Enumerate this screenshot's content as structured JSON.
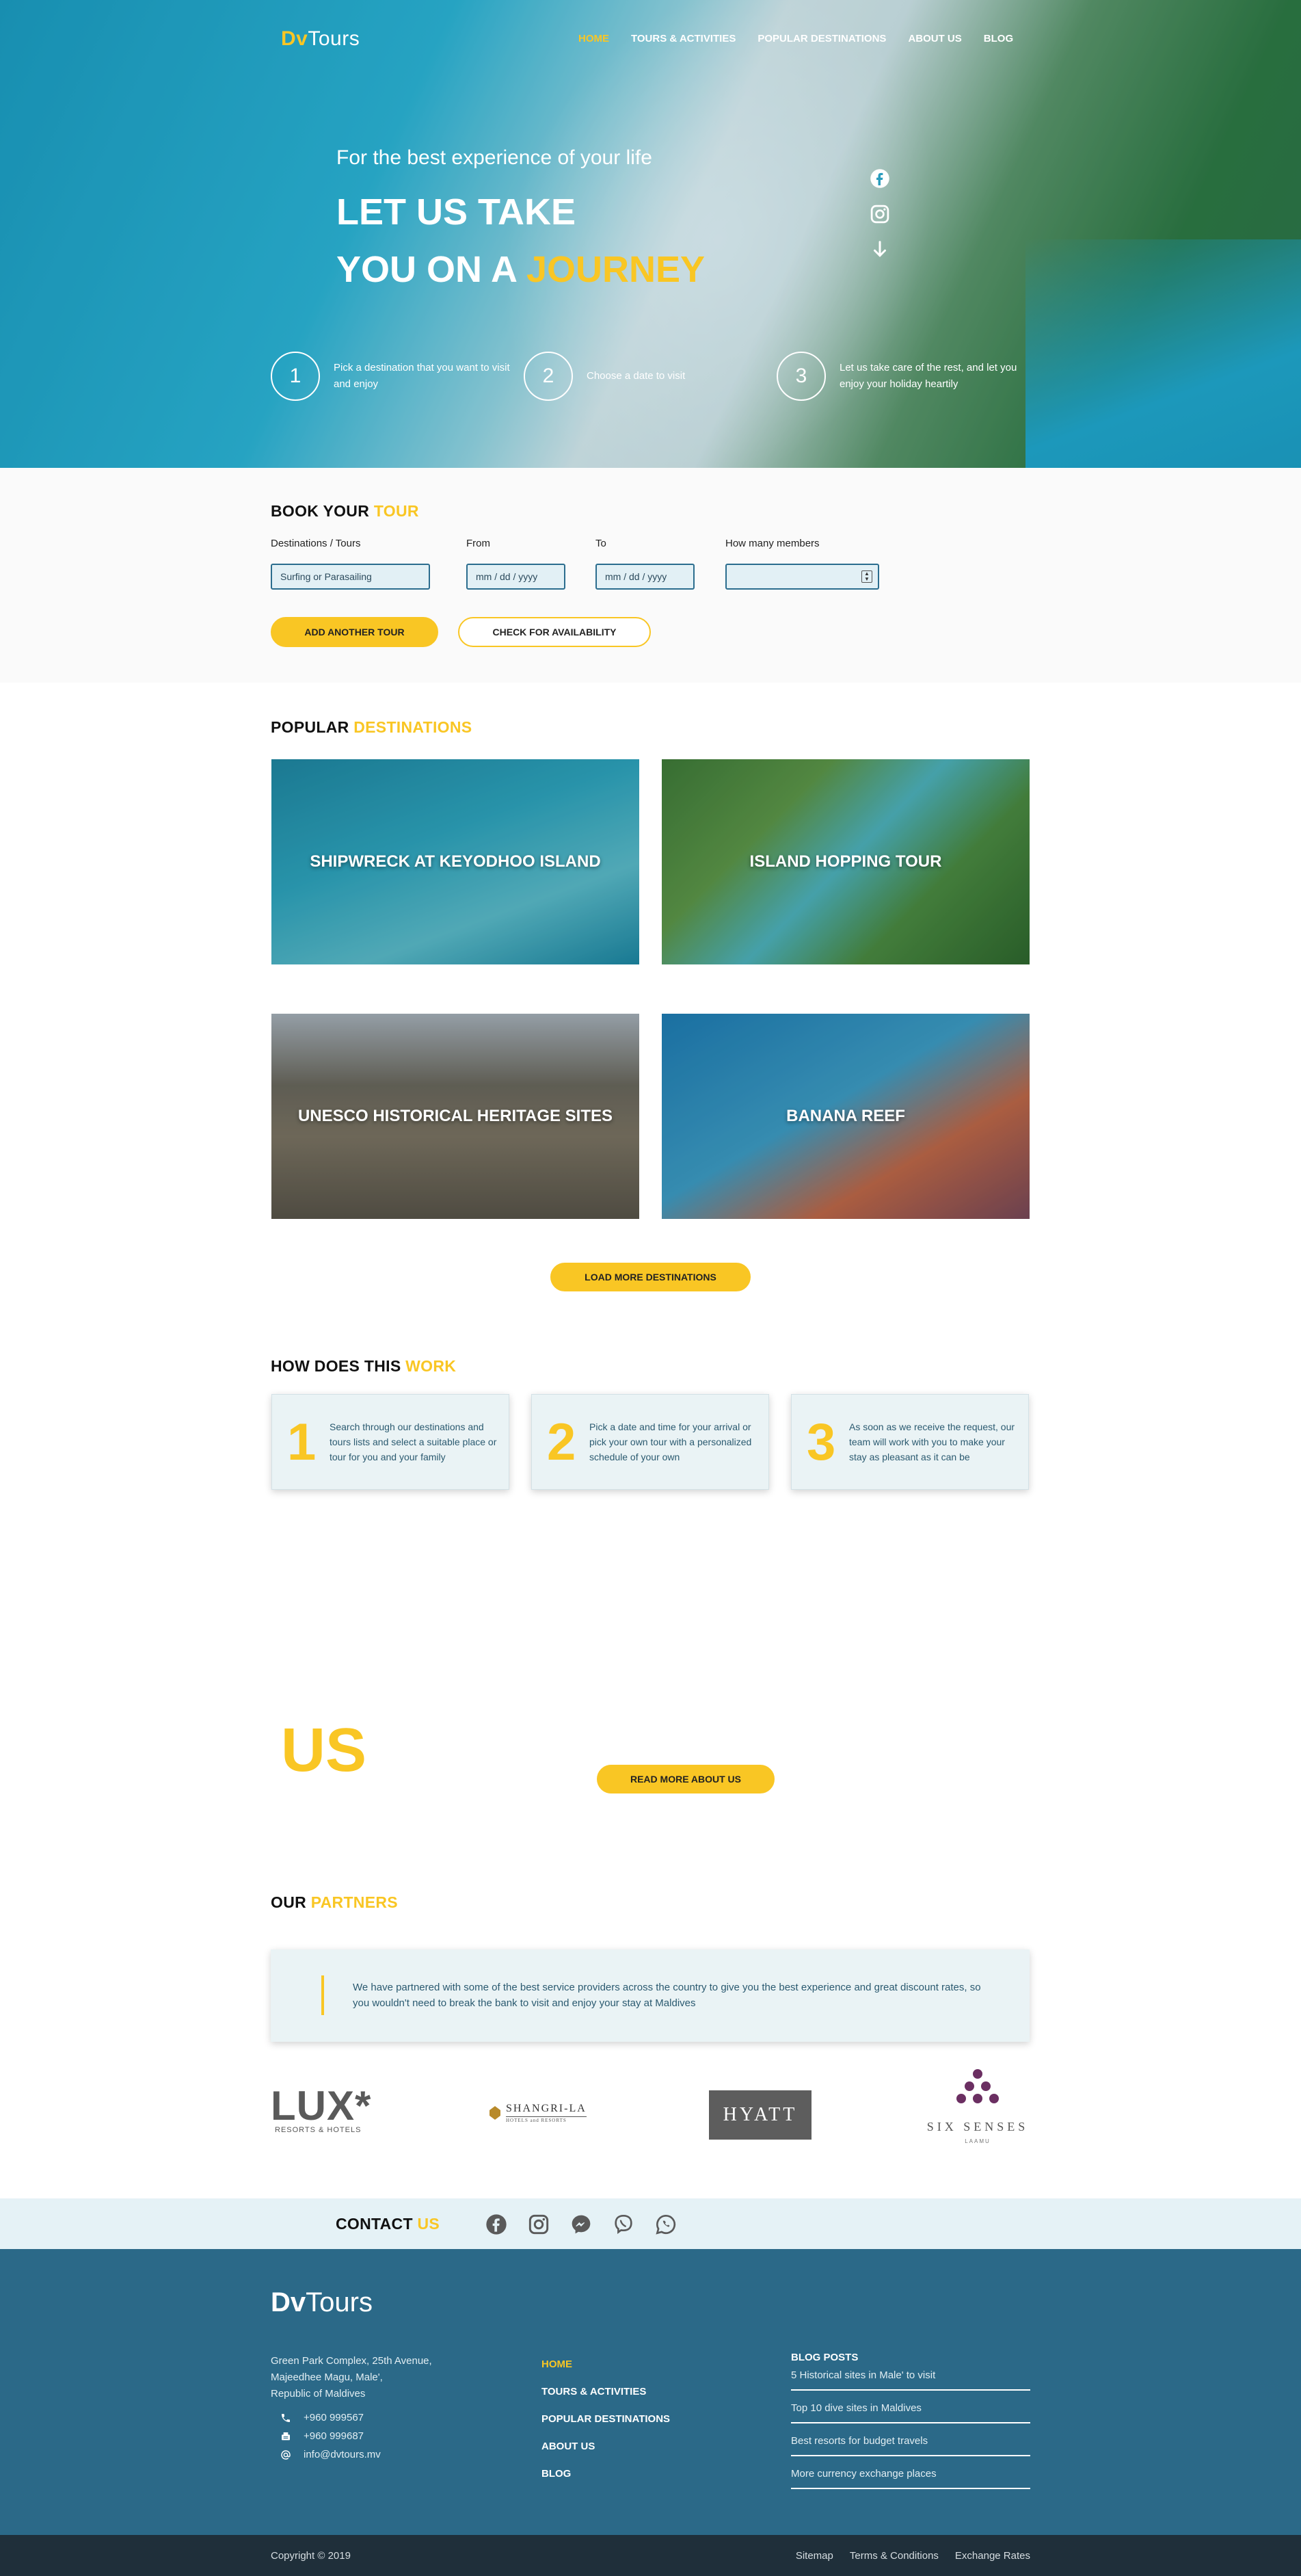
{
  "brand": {
    "bold": "Dv",
    "light": "Tours"
  },
  "nav": [
    {
      "label": "HOME",
      "active": true
    },
    {
      "label": "TOURS & ACTIVITIES"
    },
    {
      "label": "POPULAR DESTINATIONS"
    },
    {
      "label": "ABOUT US"
    },
    {
      "label": "BLOG"
    }
  ],
  "hero": {
    "subtitle": "For the best experience of your life",
    "line1": "LET US TAKE",
    "line2_prefix": "YOU ON A ",
    "line2_accent": "JOURNEY",
    "social": [
      "facebook-icon",
      "instagram-icon",
      "arrow-down-icon"
    ],
    "steps": [
      {
        "num": "1",
        "text": "Pick a destination that you want to visit and enjoy"
      },
      {
        "num": "2",
        "text": "Choose a date to visit"
      },
      {
        "num": "3",
        "text": "Let us take care of the rest, and let you enjoy your holiday heartily"
      }
    ]
  },
  "booking": {
    "title_prefix": "BOOK YOUR ",
    "title_accent": "TOUR",
    "labels": {
      "dest": "Destinations / Tours",
      "from": "From",
      "to": "To",
      "members": "How many members"
    },
    "dest_value": "Surfing or Parasailing",
    "from_placeholder": "mm / dd / yyyy",
    "to_placeholder": "mm / dd / yyyy",
    "add_tour": "ADD ANOTHER TOUR",
    "check": "CHECK FOR AVAILABILITY"
  },
  "destinations": {
    "title_prefix": "POPULAR ",
    "title_accent": "DESTINATIONS",
    "cards": [
      "SHIPWRECK AT KEYODHOO ISLAND",
      "ISLAND HOPPING TOUR",
      "UNESCO HISTORICAL HERITAGE SITES",
      "BANANA REEF"
    ],
    "load_more": "LOAD MORE DESTINATIONS"
  },
  "how": {
    "title_prefix": "HOW DOES THIS ",
    "title_accent": "WORK",
    "cards": [
      {
        "num": "1",
        "text": "Search through our destinations and tours lists and select a suitable place or tour for you and your family"
      },
      {
        "num": "2",
        "text": "Pick a date and time for your arrival or pick your own tour with a personalized schedule of your own"
      },
      {
        "num": "3",
        "text": "As soon as we receive the request, our team will work with you to make your stay as pleasant as it can be"
      }
    ]
  },
  "about": {
    "big": "US",
    "button": "READ MORE ABOUT US"
  },
  "partners": {
    "title_prefix": "OUR ",
    "title_accent": "PARTNERS",
    "text": "We have partnered with some of the best service providers across the country to give you the best experience and great discount rates, so you wouldn't need to break the bank to visit and enjoy your stay at Maldives",
    "logos": {
      "lux": "LUX*",
      "lux_sub": "RESORTS & HOTELS",
      "shangri": "SHANGRI-LA",
      "shangri_sub": "HOTELS and RESORTS",
      "hyatt": "HYATT",
      "sixsenses": "SIX SENSES",
      "sixsenses_sub": "LAAMU"
    }
  },
  "contact": {
    "title_prefix": "CONTACT ",
    "title_accent": "US",
    "icons": [
      "facebook-icon",
      "instagram-icon",
      "messenger-icon",
      "viber-icon",
      "whatsapp-icon"
    ]
  },
  "footer": {
    "address": [
      "Green Park Complex, 25th Avenue,",
      "Majeedhee Magu, Male',",
      "Republic of Maldives"
    ],
    "phone": "+960 999567",
    "fax": "+960 999687",
    "email": "info@dvtours.mv",
    "nav": [
      "HOME",
      "TOURS & ACTIVITIES",
      "POPULAR DESTINATIONS",
      "ABOUT US",
      "BLOG"
    ],
    "blog_title": "BLOG POSTS",
    "posts": [
      "5 Historical sites in Male' to visit",
      "Top 10 dive sites in Maldives",
      "Best resorts for budget travels",
      "More currency exchange places"
    ],
    "copyright": "Copyright © 2019",
    "links": [
      "Sitemap",
      "Terms & Conditions",
      "Exchange Rates"
    ]
  },
  "colors": {
    "accent": "#f9c624",
    "footer": "#2b6988",
    "bottom": "#1f2f3a",
    "field_border": "#2b6d8e"
  }
}
